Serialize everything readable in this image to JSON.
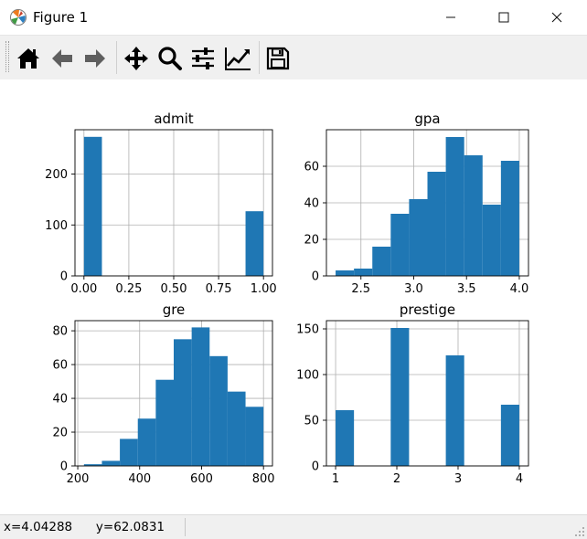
{
  "window": {
    "title": "Figure 1",
    "app_icon": "matplotlib-logo-icon",
    "controls": [
      "minimize-icon",
      "maximize-icon",
      "close-icon"
    ]
  },
  "toolbar": {
    "buttons": [
      {
        "name": "home-button",
        "icon": "home-icon"
      },
      {
        "name": "back-button",
        "icon": "arrow-left-icon"
      },
      {
        "name": "forward-button",
        "icon": "arrow-right-icon"
      },
      {
        "name": "pan-button",
        "icon": "move-arrows-icon"
      },
      {
        "name": "zoom-button",
        "icon": "magnifier-icon"
      },
      {
        "name": "configure-subplots-button",
        "icon": "sliders-icon"
      },
      {
        "name": "edit-axis-button",
        "icon": "line-chart-icon"
      },
      {
        "name": "save-button",
        "icon": "floppy-disk-icon"
      }
    ]
  },
  "status": {
    "x_label": "x=4.04288",
    "y_label": "y=62.0831"
  },
  "colors": {
    "bar": "#1f77b4",
    "grid": "#b0b0b0",
    "axes": "#000000"
  },
  "chart_data": [
    {
      "type": "bar",
      "title": "admit",
      "x_edges": [
        0,
        0.1,
        0.2,
        0.3,
        0.4,
        0.5,
        0.6,
        0.7,
        0.8,
        0.9,
        1.0
      ],
      "values": [
        273,
        0,
        0,
        0,
        0,
        0,
        0,
        0,
        0,
        127
      ],
      "xlim": [
        -0.05,
        1.05
      ],
      "ylim": [
        0,
        287
      ],
      "xticks": [
        0.0,
        0.25,
        0.5,
        0.75,
        1.0
      ],
      "xtick_labels": [
        "0.00",
        "0.25",
        "0.50",
        "0.75",
        "1.00"
      ],
      "yticks": [
        0,
        100,
        200
      ],
      "ytick_labels": [
        "0",
        "100",
        "200"
      ],
      "grid": true
    },
    {
      "type": "bar",
      "title": "gpa",
      "x_edges": [
        2.26,
        2.434,
        2.608,
        2.782,
        2.956,
        3.13,
        3.304,
        3.478,
        3.652,
        3.826,
        4.0
      ],
      "values": [
        3,
        4,
        16,
        34,
        42,
        57,
        76,
        66,
        39,
        63
      ],
      "xlim": [
        2.173,
        4.087
      ],
      "ylim": [
        0,
        80
      ],
      "xticks": [
        2.5,
        3.0,
        3.5,
        4.0
      ],
      "xtick_labels": [
        "2.5",
        "3.0",
        "3.5",
        "4.0"
      ],
      "yticks": [
        0,
        20,
        40,
        60
      ],
      "ytick_labels": [
        "0",
        "20",
        "40",
        "60"
      ],
      "grid": true
    },
    {
      "type": "bar",
      "title": "gre",
      "x_edges": [
        220,
        278,
        336,
        394,
        452,
        510,
        568,
        626,
        684,
        742,
        800
      ],
      "values": [
        1,
        3,
        16,
        28,
        51,
        75,
        82,
        65,
        44,
        35
      ],
      "xlim": [
        191,
        829
      ],
      "ylim": [
        0,
        86
      ],
      "xticks": [
        200,
        400,
        600,
        800
      ],
      "xtick_labels": [
        "200",
        "400",
        "600",
        "800"
      ],
      "yticks": [
        0,
        20,
        40,
        60,
        80
      ],
      "ytick_labels": [
        "0",
        "20",
        "40",
        "60",
        "80"
      ],
      "grid": true
    },
    {
      "type": "bar",
      "title": "prestige",
      "x_edges": [
        1.0,
        1.3,
        1.6,
        1.9,
        2.2,
        2.5,
        2.8,
        3.1,
        3.4,
        3.7,
        4.0
      ],
      "values": [
        61,
        0,
        0,
        151,
        0,
        0,
        121,
        0,
        0,
        67
      ],
      "xlim": [
        0.85,
        4.15
      ],
      "ylim": [
        0,
        159
      ],
      "xticks": [
        1,
        2,
        3,
        4
      ],
      "xtick_labels": [
        "1",
        "2",
        "3",
        "4"
      ],
      "yticks": [
        0,
        50,
        100,
        150
      ],
      "ytick_labels": [
        "0",
        "50",
        "100",
        "150"
      ],
      "grid": true
    }
  ]
}
